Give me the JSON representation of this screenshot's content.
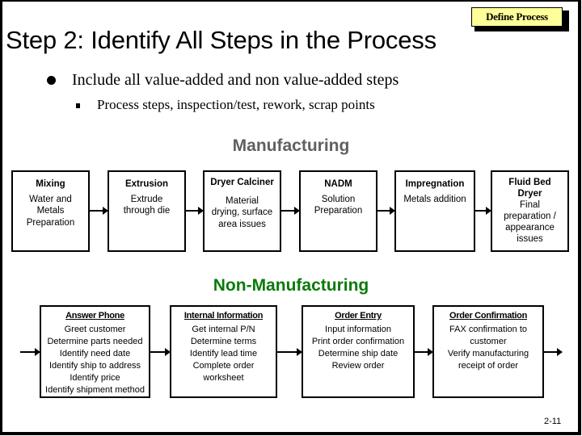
{
  "badge": {
    "label": "Define Process",
    "color": "#ffff99"
  },
  "title": "Step 2:  Identify All Steps in the Process",
  "bullets": [
    {
      "icon": "round-bullet-icon",
      "text": "Include all value-added and non value-added steps"
    },
    {
      "icon": "square-bullet-icon",
      "text": "Process steps, inspection/test, rework, scrap points"
    }
  ],
  "manufacturing": {
    "title": "Manufacturing",
    "title_color": "#606060",
    "steps": [
      {
        "name": "Mixing",
        "lines": [
          "Water and",
          "Metals",
          "Preparation"
        ]
      },
      {
        "name": "Extrusion",
        "lines": [
          "Extrude",
          "through die"
        ]
      },
      {
        "name": "Dryer Calciner",
        "lines": [
          "",
          "Material",
          "drying, surface",
          "area issues"
        ]
      },
      {
        "name": "NADM",
        "lines": [
          "Solution",
          "Preparation"
        ]
      },
      {
        "name": "Impregnation",
        "lines": [
          "Metals addition"
        ]
      },
      {
        "name": "Fluid Bed Dryer",
        "name_lines": [
          "Fluid Bed",
          "Dryer"
        ],
        "lines": [
          "Final",
          "preparation /",
          "appearance",
          "issues"
        ]
      }
    ]
  },
  "non_manufacturing": {
    "title": "Non-Manufacturing",
    "title_color": "#0a7a0a",
    "steps": [
      {
        "name": "Answer Phone",
        "lines": [
          "Greet customer",
          "Determine parts needed",
          "Identify need date",
          "Identify ship to address",
          "Identify price",
          "Identify shipment method"
        ]
      },
      {
        "name": "Internal Information",
        "lines": [
          "Get internal P/N",
          "Determine terms",
          "Identify lead time",
          "Complete order",
          "worksheet"
        ]
      },
      {
        "name": "Order Entry",
        "lines": [
          "Input information",
          "Print order confirmation",
          "Determine ship date",
          "Review order"
        ]
      },
      {
        "name": "Order Confirmation",
        "lines": [
          "FAX confirmation to",
          "customer",
          "Verify manufacturing",
          "receipt of order"
        ]
      }
    ]
  },
  "page_number": "2-11"
}
